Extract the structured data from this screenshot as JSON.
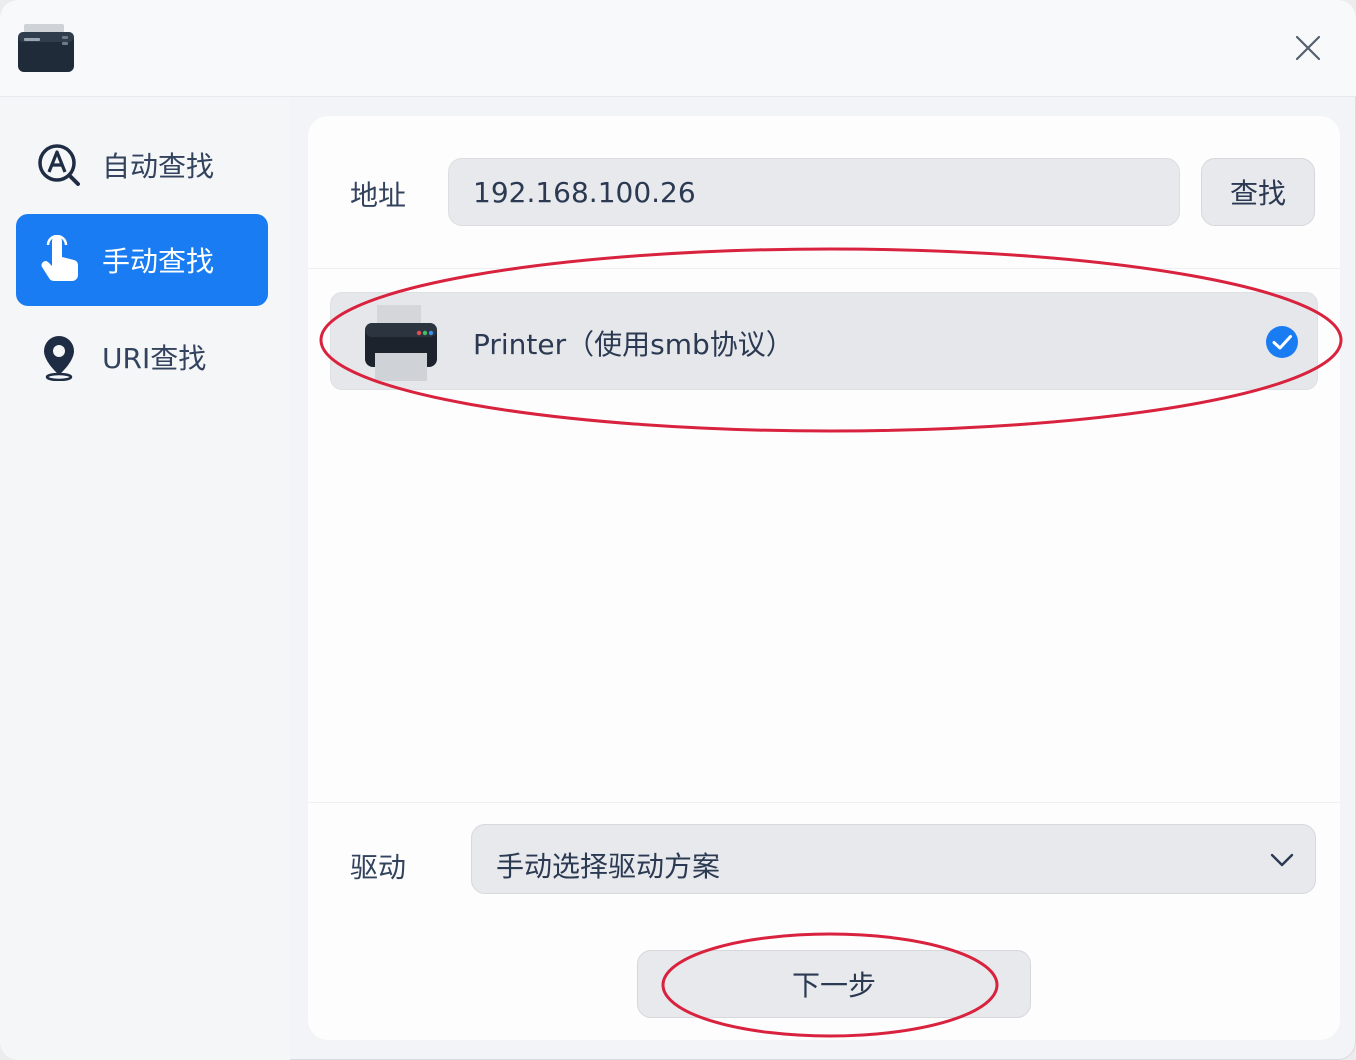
{
  "window": {
    "app_icon": "printer-app-icon",
    "close_icon": "close-icon"
  },
  "sidebar": {
    "items": [
      {
        "label": "自动查找",
        "icon": "auto-find-icon",
        "active": false
      },
      {
        "label": "手动查找",
        "icon": "hand-pointer-icon",
        "active": true
      },
      {
        "label": "URI查找",
        "icon": "location-pin-icon",
        "active": false
      }
    ]
  },
  "address": {
    "label": "地址",
    "value": "192.168.100.26",
    "find_label": "查找"
  },
  "printers": [
    {
      "name": "Printer（使用smb协议）",
      "icon": "printer-icon",
      "selected": true
    }
  ],
  "driver": {
    "label": "驱动",
    "value": "手动选择驱动方案",
    "icon": "chevron-down-icon"
  },
  "next_label": "下一步",
  "colors": {
    "accent": "#1a7cf2",
    "annotation": "#d8223e"
  }
}
